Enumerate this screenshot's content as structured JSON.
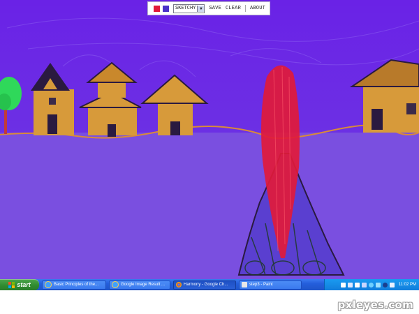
{
  "colors": {
    "sky": "#6a22e6",
    "ground": "#7a4fe0",
    "foreground_color": "#e11a3a",
    "background_color": "#4a32c8",
    "hut_fill": "#d79a3a",
    "roof_dark": "#2a1a40",
    "tree": "#2fd85a",
    "horizon": "#d88a3a",
    "taskbar": "#245edb",
    "start": "#2f8a2f"
  },
  "toolbar": {
    "foreground_swatch": "foreground-color",
    "background_swatch": "background-color",
    "brush_selected": "SKETCHY",
    "save_label": "SAVE",
    "clear_label": "CLEAR",
    "about_label": "ABOUT"
  },
  "taskbar": {
    "start_label": "start",
    "tasks": [
      {
        "label": "Basic Principles of the...",
        "icon": "ie-icon"
      },
      {
        "label": "Google Image Result ...",
        "icon": "ie-icon"
      },
      {
        "label": "Harmony - Google Ch...",
        "icon": "chrome-icon"
      },
      {
        "label": "step3 - Paint",
        "icon": "paint-icon"
      }
    ],
    "clock": "11:02 PM"
  },
  "watermark": "pxleyes.com"
}
